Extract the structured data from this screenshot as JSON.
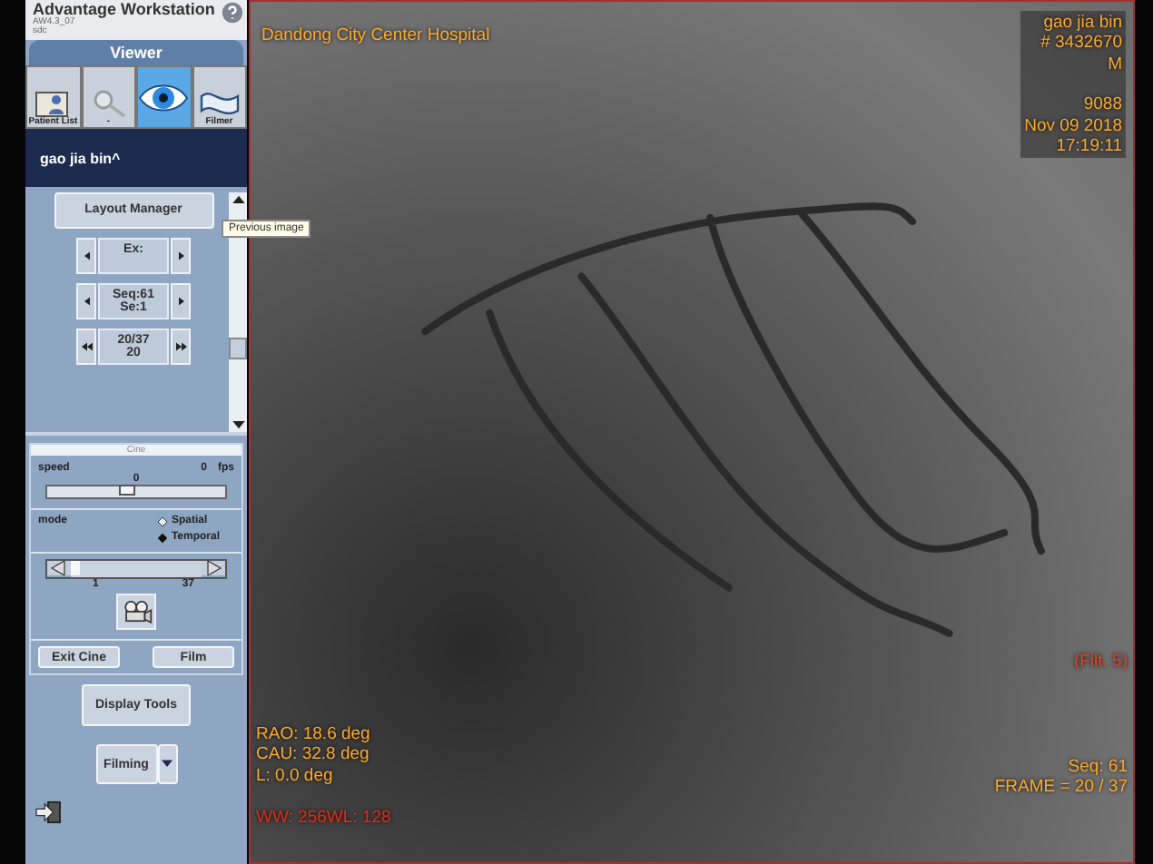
{
  "app": {
    "title": "Advantage Workstation",
    "version": "AW4.3_07",
    "host": "sdc"
  },
  "view_tab": {
    "label": "Viewer",
    "selected": true
  },
  "tools": [
    {
      "kind": "patient",
      "label": "Patient List",
      "selected": false
    },
    {
      "kind": "magnifier",
      "label": "-",
      "selected": false
    },
    {
      "kind": "eye",
      "selected": true
    },
    {
      "kind": "filmer",
      "label": "Filmer",
      "selected": false
    }
  ],
  "patient_name": "gao jia bin^",
  "layout_button": "Layout Manager",
  "navigators": [
    {
      "kind": "single",
      "value": "Ex:"
    },
    {
      "kind": "single",
      "value": "Seq:61\nSe:1"
    },
    {
      "kind": "double",
      "value": "20/37\n20"
    }
  ],
  "tooltip": "Previous image",
  "cine": {
    "title": "Cine",
    "speed_label": "speed",
    "speed_value": "0",
    "speed_unit": "fps",
    "speed_slider": {
      "value": "0",
      "level": 0.45
    },
    "mode_label": "mode",
    "modes": [
      {
        "label": "Spatial",
        "selected": false
      },
      {
        "label": "Temporal",
        "selected": true
      }
    ],
    "frame_slider": {
      "level": 0,
      "min": "1",
      "max": "37"
    },
    "buttons": [
      "Exit Cine",
      "Film"
    ]
  },
  "display_tools": "Display Tools",
  "filming": "Filming",
  "overlay": {
    "hospital": "Dandong City Center Hospital",
    "patient_lines": [
      "gao  jia  bin",
      "# 3432670",
      "M"
    ],
    "study_lines": [
      "9088",
      "Nov 09 2018",
      "17:19:11"
    ],
    "angles": [
      "RAO: 18.6 deg",
      "CAU: 32.8 deg",
      "L: 0.0 deg"
    ],
    "window": "WW: 256WL: 128",
    "filter": "(Filt. 5)",
    "seq": "Seq: 61",
    "frame": "FRAME = 20 / 37"
  }
}
